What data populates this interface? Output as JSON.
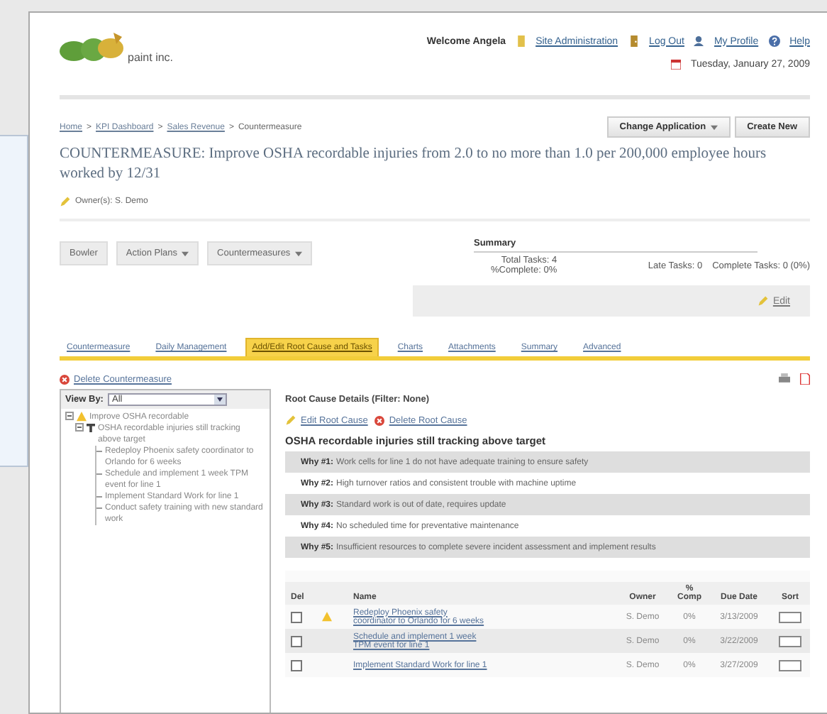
{
  "header": {
    "logo_text": "paint inc.",
    "welcome": "Welcome Angela",
    "links": [
      {
        "label": "Site Administration",
        "kind": "admin"
      },
      {
        "label": "Log Out",
        "kind": "logout"
      },
      {
        "label": "My Profile",
        "kind": "profile"
      },
      {
        "label": "Help",
        "kind": "help"
      }
    ],
    "date": "Tuesday, January 27, 2009"
  },
  "breadcrumb": {
    "items": [
      "Home",
      "KPI Dashboard",
      "Sales Revenue"
    ],
    "current": "Countermeasure",
    "separator": ">"
  },
  "app_buttons": [
    {
      "label": "Change Application",
      "dropdown": true
    },
    {
      "label": "Create New",
      "dropdown": false
    }
  ],
  "title": "COUNTERMEASURE: Improve OSHA recordable injuries from 2.0 to no more than 1.0 per 200,000 employee hours worked by 12/31",
  "owner": "Owner(s): S. Demo",
  "toolbar": [
    {
      "label": "Bowler",
      "dropdown": false
    },
    {
      "label": "Action Plans",
      "dropdown": true
    },
    {
      "label": "Countermeasures",
      "dropdown": true
    }
  ],
  "summary": {
    "title": "Summary",
    "total": "Total Tasks: 4",
    "percent": "%Complete: 0%",
    "late": "Late Tasks: 0",
    "complete": "Complete Tasks: 0 (0%)"
  },
  "edit_link": "Edit",
  "tabs": [
    {
      "label": "Countermeasure",
      "selected": false
    },
    {
      "label": "Daily Management",
      "selected": false
    },
    {
      "label": "Add/Edit Root Cause and Tasks",
      "selected": true
    },
    {
      "label": "Charts",
      "selected": false
    },
    {
      "label": "Attachments",
      "selected": false
    },
    {
      "label": "Summary",
      "selected": false
    },
    {
      "label": "Advanced",
      "selected": false
    }
  ],
  "delete_countermeasure": "Delete Countermeasure",
  "tree": {
    "view_by_label": "View By:",
    "view_by_value": "All",
    "items": [
      {
        "label": "Improve OSHA recordable",
        "kind": "objective",
        "children": [
          {
            "label": "OSHA recordable injuries still tracking above target",
            "kind": "root_cause",
            "children": [
              {
                "label": "Redeploy Phoenix safety coordinator to Orlando for 6 weeks",
                "kind": "task"
              },
              {
                "label": "Schedule and implement 1 week TPM event for line 1",
                "kind": "task"
              },
              {
                "label": "Implement Standard Work for line 1",
                "kind": "task"
              },
              {
                "label": "Conduct safety training with new standard work",
                "kind": "task"
              }
            ]
          }
        ]
      }
    ]
  },
  "root_cause": {
    "heading": "Root Cause Details (Filter: None)",
    "actions": [
      {
        "label": "Edit Root Cause",
        "kind": "edit"
      },
      {
        "label": "Delete Root Cause",
        "kind": "delete"
      }
    ],
    "title": "OSHA recordable injuries still tracking above target",
    "whys": [
      {
        "label": "Why #1:",
        "text": "Work cells for line 1 do not have adequate training to ensure safety"
      },
      {
        "label": "Why #2:",
        "text": "High turnover ratios and consistent trouble with machine uptime"
      },
      {
        "label": "Why #3:",
        "text": "Standard work is out of date, requires update"
      },
      {
        "label": "Why #4:",
        "text": "No scheduled time for preventative maintenance"
      },
      {
        "label": "Why #5:",
        "text": "Insufficient resources to complete severe incident assessment and implement results"
      }
    ]
  },
  "tasks": {
    "columns": [
      "Del",
      "Name",
      "Owner",
      "% Comp",
      "Due Date",
      "Sort"
    ],
    "rows": [
      {
        "checked": false,
        "warning": true,
        "name": "Redeploy Phoenix safety coordinator to Orlando for 6 weeks",
        "owner": "S. Demo",
        "comp": "0%",
        "due": "3/13/2009"
      },
      {
        "checked": false,
        "warning": false,
        "name": "Schedule and implement 1 week TPM event for line 1",
        "owner": "S. Demo",
        "comp": "0%",
        "due": "3/22/2009"
      },
      {
        "checked": false,
        "warning": false,
        "name": "Implement Standard Work for line 1",
        "owner": "S. Demo",
        "comp": "0%",
        "due": "3/27/2009"
      }
    ]
  }
}
